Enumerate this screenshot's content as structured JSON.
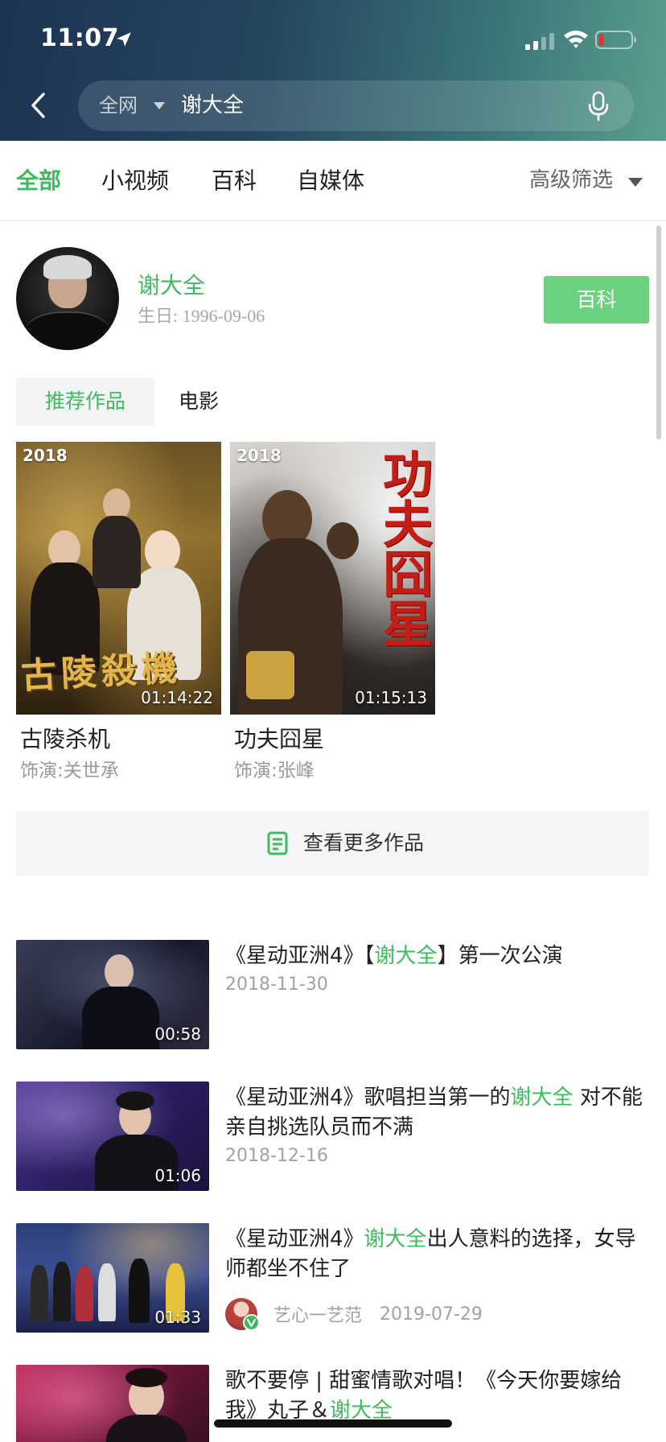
{
  "status_bar": {
    "time": "11:07"
  },
  "search": {
    "scope": "全网",
    "query": "谢大全"
  },
  "tabs": [
    {
      "label": "全部",
      "active": true
    },
    {
      "label": "小视频"
    },
    {
      "label": "百科"
    },
    {
      "label": "自媒体"
    }
  ],
  "filter": {
    "label": "高级筛选"
  },
  "profile": {
    "name": "谢大全",
    "birthday": "生日: 1996-09-06",
    "baike_button": "百科"
  },
  "works_tabs": [
    {
      "label": "推荐作品",
      "active": true
    },
    {
      "label": "电影"
    }
  ],
  "works": [
    {
      "year": "2018",
      "duration": "01:14:22",
      "title": "古陵杀机",
      "role": "饰演:关世承",
      "poster_art": "古陵殺機"
    },
    {
      "year": "2018",
      "duration": "01:15:13",
      "title": "功夫囧星",
      "role": "饰演:张峰",
      "poster_art": "功夫囧星"
    }
  ],
  "more_works": "查看更多作品",
  "videos": [
    {
      "duration": "00:58",
      "title": [
        {
          "text": "《星动亚洲4》【"
        },
        {
          "text": "谢大全",
          "highlight": true
        },
        {
          "text": "】第一次公演"
        }
      ],
      "date": "2018-11-30"
    },
    {
      "duration": "01:06",
      "title": [
        {
          "text": "《星动亚洲4》歌唱担当第一的"
        },
        {
          "text": "谢大全",
          "highlight": true
        },
        {
          "text": " 对不能亲自挑选队员而不满"
        }
      ],
      "date": "2018-12-16"
    },
    {
      "duration": "01:33",
      "title": [
        {
          "text": "《星动亚洲4》"
        },
        {
          "text": "谢大全",
          "highlight": true
        },
        {
          "text": "出人意料的选择，女导师都坐不住了"
        }
      ],
      "author": "艺心一艺范",
      "date": "2019-07-29"
    },
    {
      "duration": "",
      "title": [
        {
          "text": "歌不要停 | 甜蜜情歌对唱！《今天你要嫁给我》丸子＆"
        },
        {
          "text": "谢大全",
          "highlight": true
        }
      ]
    }
  ],
  "icons": {
    "location": "location-arrow-icon",
    "signal": "signal-icon",
    "wifi": "wifi-icon",
    "battery": "battery-icon",
    "back": "chevron-left-icon",
    "mic": "microphone-icon",
    "more": "document-icon",
    "verified": "verified-badge-icon"
  },
  "colors": {
    "accent": "#3dbb5d",
    "button": "#6bd17f",
    "header_start": "#1d3354",
    "header_end": "#5c9f90",
    "battery_low": "#e5332a"
  }
}
